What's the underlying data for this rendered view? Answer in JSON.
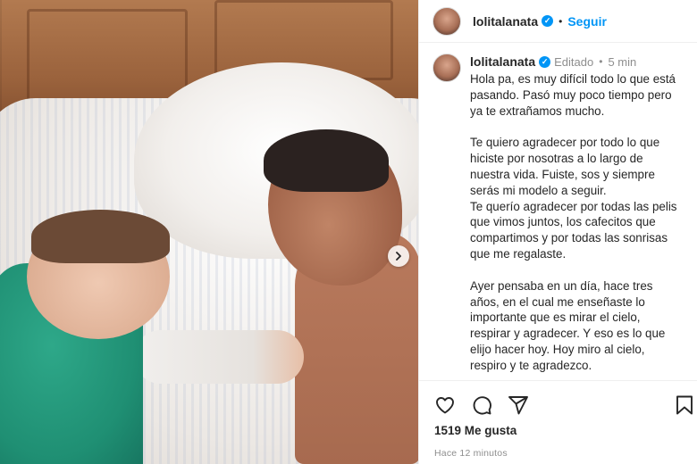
{
  "post": {
    "username": "lolitalanata",
    "follow_label": "Seguir",
    "separator": "•",
    "edited_label": "Editado",
    "time_ago": "5 min",
    "caption_lines": [
      "Hola pa, es muy difícil todo lo que está",
      "pasando. Pasó muy poco tiempo pero",
      "ya te extrañamos mucho.",
      "",
      "Te quiero agradecer por todo lo que",
      "hiciste por nosotras a lo largo de",
      "nuestra vida. Fuiste, sos y siempre",
      "serás mi modelo a seguir.",
      "Te querío agradecer por todas las pelis",
      "que vimos juntos, los cafecitos que",
      "compartimos y por todas las sonrisas",
      "que me regalaste.",
      "",
      "Ayer pensaba en un día, hace tres",
      "años, en el cual me enseñaste lo",
      "importante que es mirar el cielo,",
      "respirar y agradecer. Y eso es lo que",
      "elijo hacer hoy. Hoy miro al cielo,",
      "respiro y te agradezco."
    ],
    "likes_label": "1519 Me gusta",
    "posted_ago": "Hace 12 minutos"
  },
  "icons": {
    "like": "heart-icon",
    "comment": "comment-icon",
    "share": "send-icon",
    "save": "bookmark-icon",
    "next": "chevron-right-icon",
    "verified": "verified-badge-icon"
  },
  "colors": {
    "accent": "#0095f6",
    "text": "#262626",
    "muted": "#8e8e8e"
  }
}
